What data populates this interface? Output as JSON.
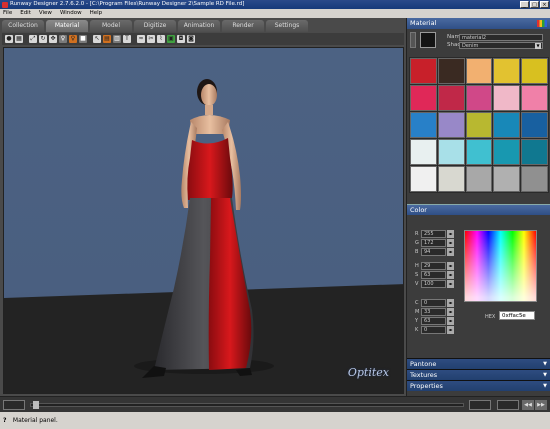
{
  "window": {
    "title": "Runway Designer 2.7.6.2.0 - [C:\\Program Files\\Runway Designer 2\\Sample RD File.rd]",
    "controls": [
      "_",
      "□",
      "×"
    ]
  },
  "menu": [
    "File",
    "Edit",
    "View",
    "Window",
    "Help"
  ],
  "tabs": [
    "Collection",
    "Material",
    "Model",
    "Digitize",
    "Animation",
    "Render",
    "Settings"
  ],
  "active_tab": "Material",
  "watermark": "Optitex",
  "status": {
    "text": "Material panel."
  },
  "material_panel": {
    "title": "Material",
    "name_label": "Name",
    "name_value": "material2",
    "shader_label": "Shader",
    "shader_value": "Denim",
    "swatch_color": "#141414",
    "palette": [
      "#c8202a",
      "#3a2a22",
      "#f2b070",
      "#e2c230",
      "#d8c020",
      "#e02858",
      "#c02848",
      "#d04888",
      "#f0b8c8",
      "#f080a8",
      "#2880c8",
      "#9888c8",
      "#b8b830",
      "#1888b8",
      "#1860a0",
      "#e8f0f0",
      "#a8e0e8",
      "#40c0d0",
      "#1898b0",
      "#107890",
      "#f0f0f0",
      "#d8d8d0",
      "#a8a8a8",
      "#b0b0b0",
      "#909090"
    ]
  },
  "color_panel": {
    "title": "Color",
    "fields": [
      {
        "label": "R",
        "value": "255"
      },
      {
        "label": "G",
        "value": "172"
      },
      {
        "label": "B",
        "value": "94"
      },
      {
        "label": "H",
        "value": "29"
      },
      {
        "label": "S",
        "value": "63"
      },
      {
        "label": "V",
        "value": "100"
      },
      {
        "label": "C",
        "value": "0"
      },
      {
        "label": "M",
        "value": "33"
      },
      {
        "label": "Y",
        "value": "63"
      },
      {
        "label": "K",
        "value": "0"
      }
    ],
    "hex_label": "HEX",
    "hex_value": "0xffac5e"
  },
  "collapsed_panels": [
    "Pantone",
    "Textures",
    "Properties"
  ]
}
